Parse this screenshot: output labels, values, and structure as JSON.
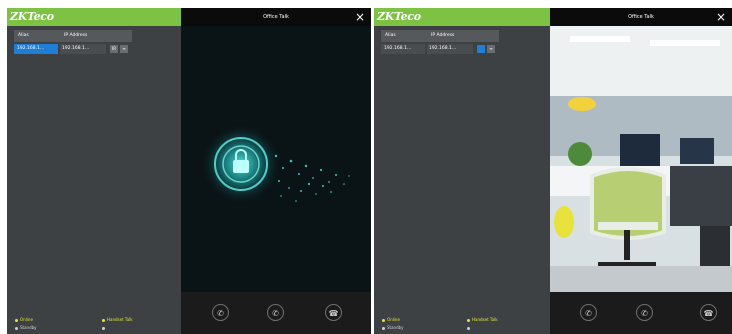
{
  "logo_text": "ZKTeco",
  "table": {
    "col_name": "Alias",
    "col_ip": "IP Address"
  },
  "screens": [
    {
      "row": {
        "name": "192.168.1...",
        "ip": "192.168.1...",
        "action_1": "IR",
        "action_2": "≡"
      },
      "video_title": "Office Talk",
      "close": "×",
      "legend": {
        "online": "Online",
        "idle": "Handset Talk",
        "offline": "Standby"
      }
    },
    {
      "row": {
        "name": "192.168.1...",
        "ip": "192.168.1...",
        "action_1": "",
        "action_2": "≡"
      },
      "video_title": "Office Talk",
      "close": "×",
      "legend": {
        "online": "Online",
        "idle": "Handset Talk",
        "offline": "Standby"
      }
    }
  ],
  "call_icons": [
    "phone-left",
    "phone-center",
    "hangup"
  ],
  "colors": {
    "brand_green": "#7ec244",
    "panel": "#3e4143",
    "select_blue": "#1f7fd8",
    "status_yellow": "#e6e43a"
  }
}
